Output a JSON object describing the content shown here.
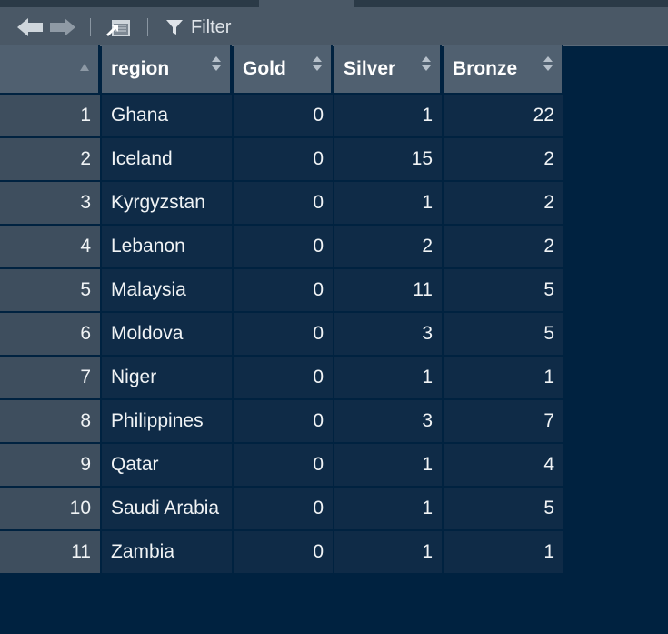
{
  "toolbar": {
    "filter_label": "Filter"
  },
  "table": {
    "columns": [
      "region",
      "Gold",
      "Silver",
      "Bronze"
    ],
    "rows": [
      {
        "idx": "1",
        "region": "Ghana",
        "gold": "0",
        "silver": "1",
        "bronze": "22"
      },
      {
        "idx": "2",
        "region": "Iceland",
        "gold": "0",
        "silver": "15",
        "bronze": "2"
      },
      {
        "idx": "3",
        "region": "Kyrgyzstan",
        "gold": "0",
        "silver": "1",
        "bronze": "2"
      },
      {
        "idx": "4",
        "region": "Lebanon",
        "gold": "0",
        "silver": "2",
        "bronze": "2"
      },
      {
        "idx": "5",
        "region": "Malaysia",
        "gold": "0",
        "silver": "11",
        "bronze": "5"
      },
      {
        "idx": "6",
        "region": "Moldova",
        "gold": "0",
        "silver": "3",
        "bronze": "5"
      },
      {
        "idx": "7",
        "region": "Niger",
        "gold": "0",
        "silver": "1",
        "bronze": "1"
      },
      {
        "idx": "8",
        "region": "Philippines",
        "gold": "0",
        "silver": "3",
        "bronze": "7"
      },
      {
        "idx": "9",
        "region": "Qatar",
        "gold": "0",
        "silver": "1",
        "bronze": "4"
      },
      {
        "idx": "10",
        "region": "Saudi Arabia",
        "gold": "0",
        "silver": "1",
        "bronze": "5"
      },
      {
        "idx": "11",
        "region": "Zambia",
        "gold": "0",
        "silver": "1",
        "bronze": "1"
      }
    ]
  },
  "icons": {
    "back": "arrow-left-icon",
    "forward": "arrow-right-icon",
    "popout": "show-in-window-icon",
    "filter": "filter-funnel-icon"
  }
}
